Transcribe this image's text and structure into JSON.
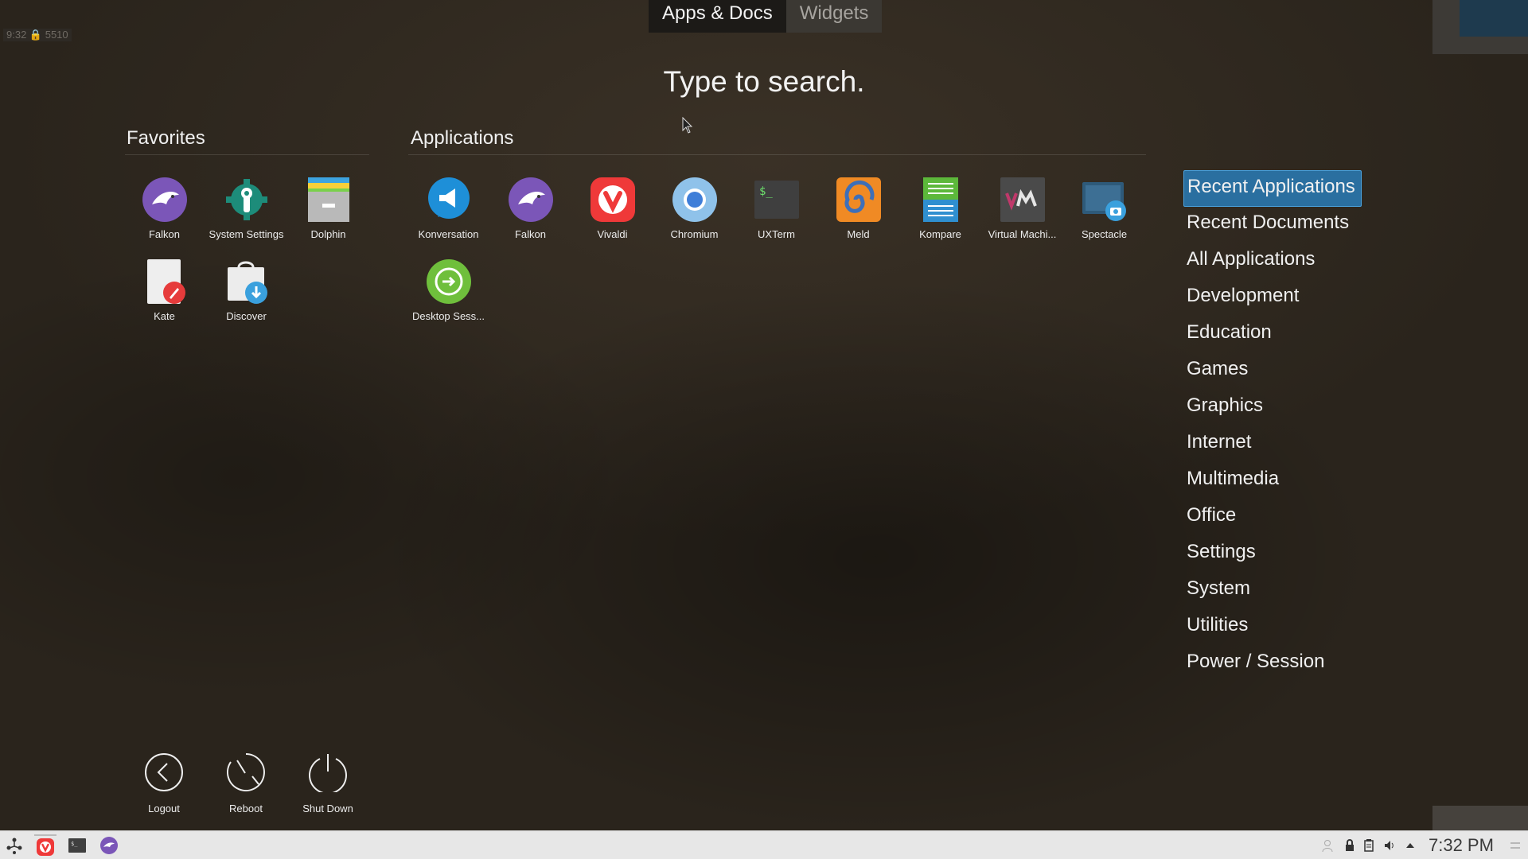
{
  "tabs": {
    "apps_docs": "Apps & Docs",
    "widgets": "Widgets"
  },
  "search_hint": "Type to search.",
  "topleft": "9:32  🔒 5510",
  "favorites": {
    "title": "Favorites",
    "items": [
      {
        "label": "Falkon",
        "icon": "falkon-icon"
      },
      {
        "label": "System Settings",
        "icon": "system-settings-icon"
      },
      {
        "label": "Dolphin",
        "icon": "dolphin-icon"
      },
      {
        "label": "Kate",
        "icon": "kate-icon"
      },
      {
        "label": "Discover",
        "icon": "discover-icon"
      }
    ]
  },
  "applications": {
    "title": "Applications",
    "items": [
      {
        "label": "Konversation",
        "icon": "konversation-icon"
      },
      {
        "label": "Falkon",
        "icon": "falkon-icon"
      },
      {
        "label": "Vivaldi",
        "icon": "vivaldi-icon"
      },
      {
        "label": "Chromium",
        "icon": "chromium-icon"
      },
      {
        "label": "UXTerm",
        "icon": "terminal-icon"
      },
      {
        "label": "Meld",
        "icon": "meld-icon"
      },
      {
        "label": "Kompare",
        "icon": "kompare-icon"
      },
      {
        "label": "Virtual Machi...",
        "icon": "virtual-machine-icon"
      },
      {
        "label": "Spectacle",
        "icon": "spectacle-icon"
      },
      {
        "label": "Desktop Sess...",
        "icon": "desktop-session-icon"
      }
    ]
  },
  "categories": [
    "Recent Applications",
    "Recent Documents",
    "All Applications",
    "Development",
    "Education",
    "Games",
    "Graphics",
    "Internet",
    "Multimedia",
    "Office",
    "Settings",
    "System",
    "Utilities",
    "Power / Session"
  ],
  "selected_category": "Recent Applications",
  "power": {
    "logout": "Logout",
    "reboot": "Reboot",
    "shutdown": "Shut Down"
  },
  "taskbar": {
    "clock": "7:32 PM"
  },
  "colors": {
    "accent": "#2a6fa0",
    "taskbar": "#e7e7e7"
  }
}
